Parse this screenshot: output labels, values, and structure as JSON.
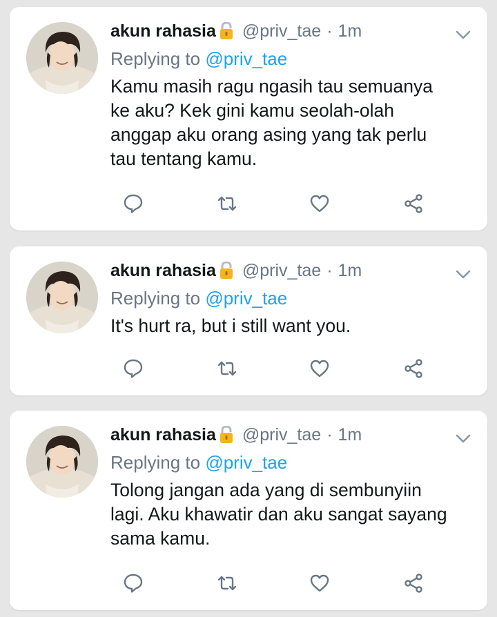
{
  "colors": {
    "background": "#e6e6e6",
    "card": "#ffffff",
    "primary_text": "#14171a",
    "secondary_text": "#687684",
    "mention": "#1da1f2",
    "lock": "#f5b41e"
  },
  "icons": [
    "profile-avatar",
    "padlock-icon",
    "chevron-down-icon",
    "reply-icon",
    "retweet-icon",
    "like-icon",
    "share-icon"
  ],
  "tweets": [
    {
      "display_name": "akun rahasia",
      "handle": "@priv_tae",
      "separator": "·",
      "time": "1m",
      "replying_to_label": "Replying to",
      "replying_to_handle": "@priv_tae",
      "text": "Kamu masih ragu ngasih tau semuanya\nke aku? Kek gini kamu seolah-olah\nanggap aku orang asing yang tak perlu\ntau tentang kamu."
    },
    {
      "display_name": "akun rahasia",
      "handle": "@priv_tae",
      "separator": "·",
      "time": "1m",
      "replying_to_label": "Replying to",
      "replying_to_handle": "@priv_tae",
      "text": "It's hurt ra, but i still want you."
    },
    {
      "display_name": "akun rahasia",
      "handle": "@priv_tae",
      "separator": "·",
      "time": "1m",
      "replying_to_label": "Replying to",
      "replying_to_handle": "@priv_tae",
      "text": "Tolong jangan ada yang di sembunyiin\nlagi. Aku khawatir dan aku sangat sayang\nsama kamu."
    }
  ]
}
